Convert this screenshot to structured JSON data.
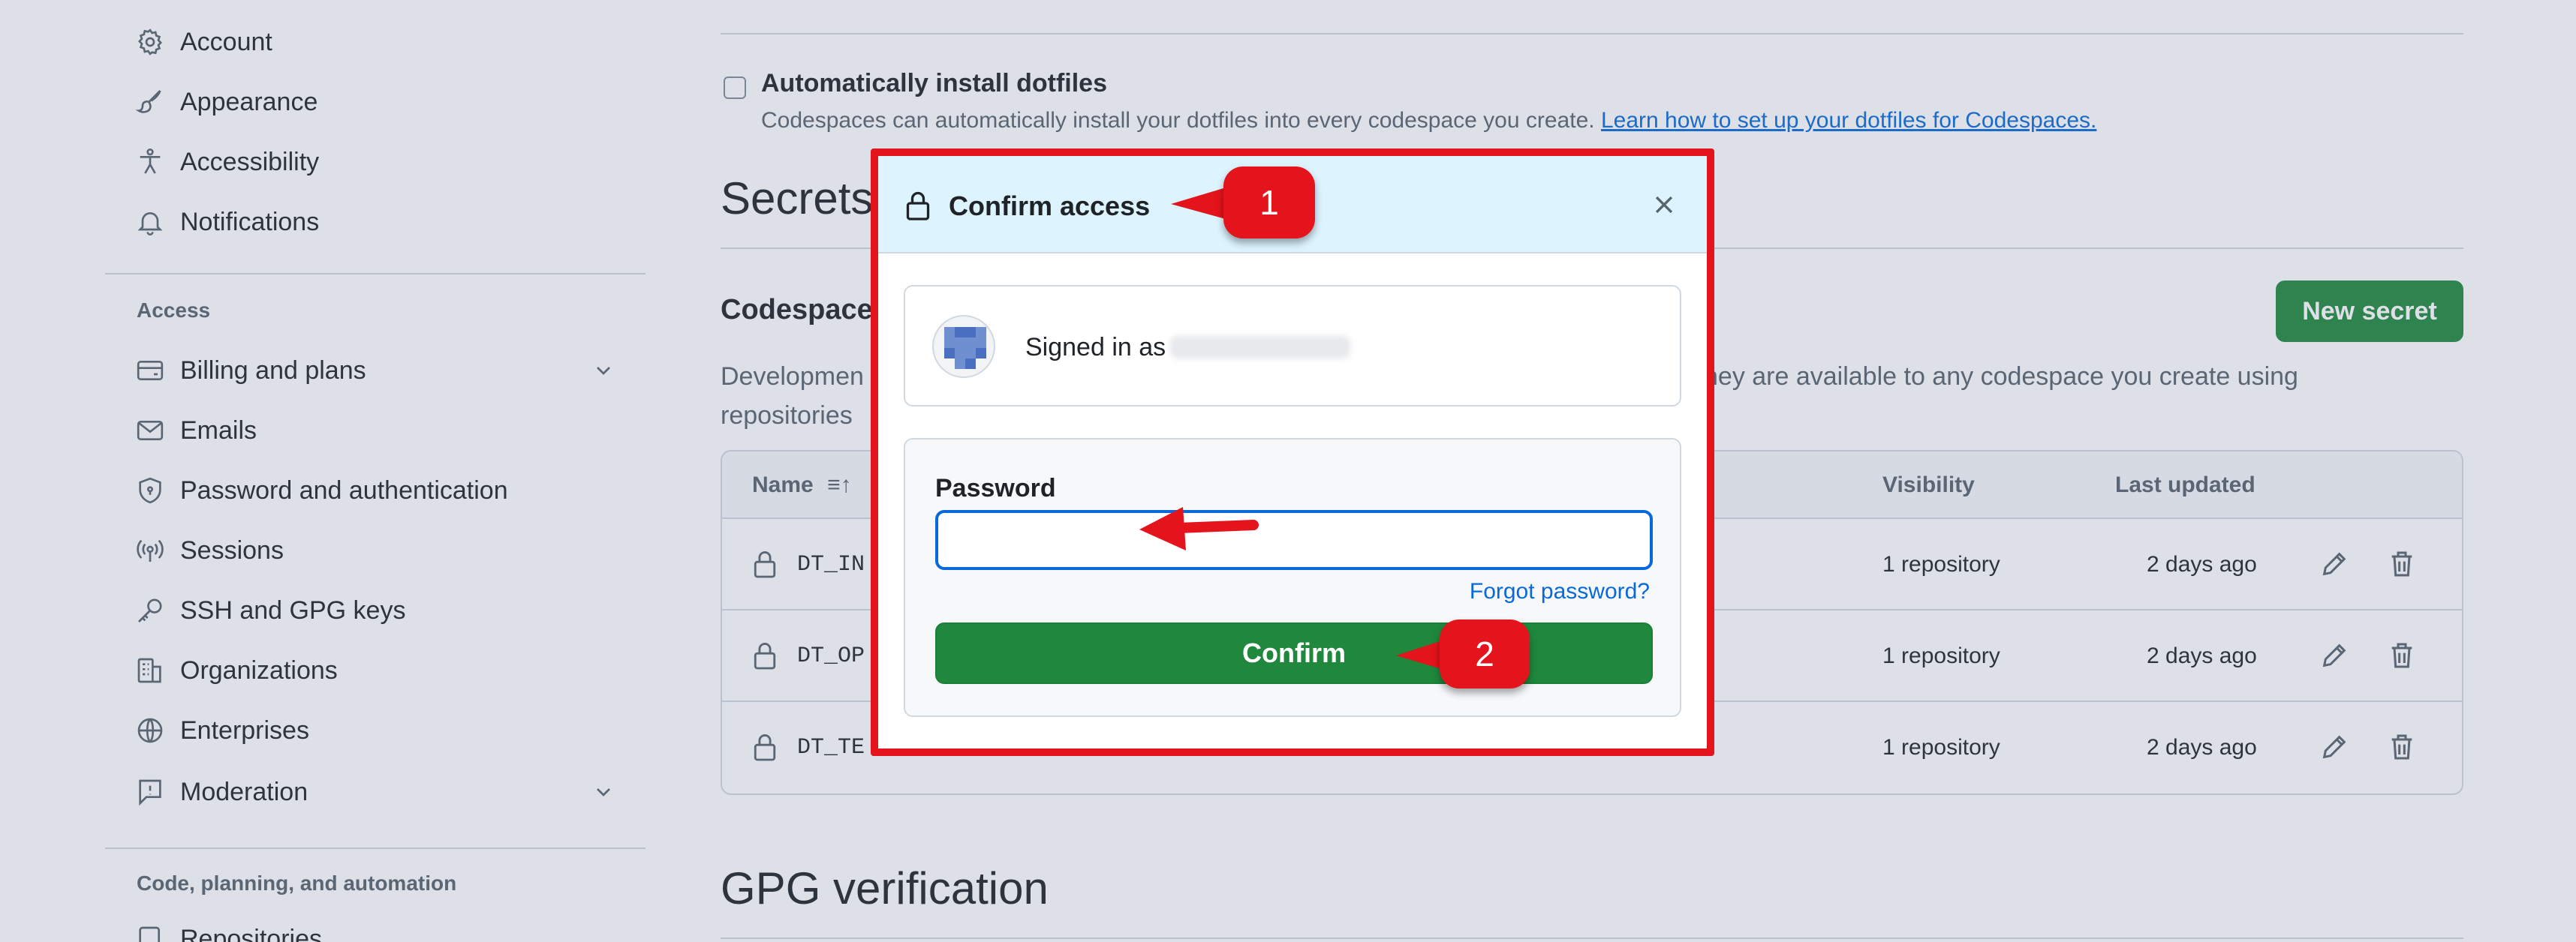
{
  "sidebar": {
    "items_top": [
      {
        "label": "Account",
        "icon": "gear-icon"
      },
      {
        "label": "Appearance",
        "icon": "paintbrush-icon"
      },
      {
        "label": "Accessibility",
        "icon": "accessibility-icon"
      },
      {
        "label": "Notifications",
        "icon": "bell-icon"
      }
    ],
    "access_label": "Access",
    "items_access": [
      {
        "label": "Billing and plans",
        "icon": "credit-card-icon"
      },
      {
        "label": "Emails",
        "icon": "mail-icon"
      },
      {
        "label": "Password and authentication",
        "icon": "shield-lock-icon"
      },
      {
        "label": "Sessions",
        "icon": "broadcast-icon"
      },
      {
        "label": "SSH and GPG keys",
        "icon": "key-icon"
      },
      {
        "label": "Organizations",
        "icon": "organization-icon"
      },
      {
        "label": "Enterprises",
        "icon": "globe-icon"
      },
      {
        "label": "Moderation",
        "icon": "report-icon"
      }
    ],
    "code_label": "Code, planning, and automation",
    "items_code": [
      {
        "label": "Repositories",
        "icon": "repo-icon"
      }
    ]
  },
  "main": {
    "dotfiles": {
      "title": "Automatically install dotfiles",
      "desc": "Codespaces can automatically install your dotfiles into every codespace you create.",
      "link": "Learn how to set up your dotfiles for Codespaces."
    },
    "secrets_heading": "Secrets",
    "codespaces_heading": "Codespaces",
    "new_secret": "New secret",
    "desc_left": "Developmen",
    "desc_left_2": "repositories",
    "desc_right": "hey are available to any codespace you create using",
    "table": {
      "col_name": "Name",
      "col_visibility": "Visibility",
      "col_updated": "Last updated",
      "rows": [
        {
          "name": "DT_IN",
          "visibility": "1 repository",
          "updated": "2 days ago"
        },
        {
          "name": "DT_OP",
          "visibility": "1 repository",
          "updated": "2 days ago"
        },
        {
          "name": "DT_TE",
          "visibility": "1 repository",
          "updated": "2 days ago"
        }
      ]
    },
    "gpg_heading": "GPG verification"
  },
  "dialog": {
    "title": "Confirm access",
    "signed_in_as": "Signed in as",
    "password_label": "Password",
    "password_value": "",
    "forgot": "Forgot password?",
    "confirm": "Confirm"
  },
  "annotations": {
    "step1": "1",
    "step2": "2",
    "color": "#e3141c"
  },
  "colors": {
    "accent": "#0969da",
    "primary_button": "#1f883d",
    "dialog_header": "#ddf4ff"
  }
}
